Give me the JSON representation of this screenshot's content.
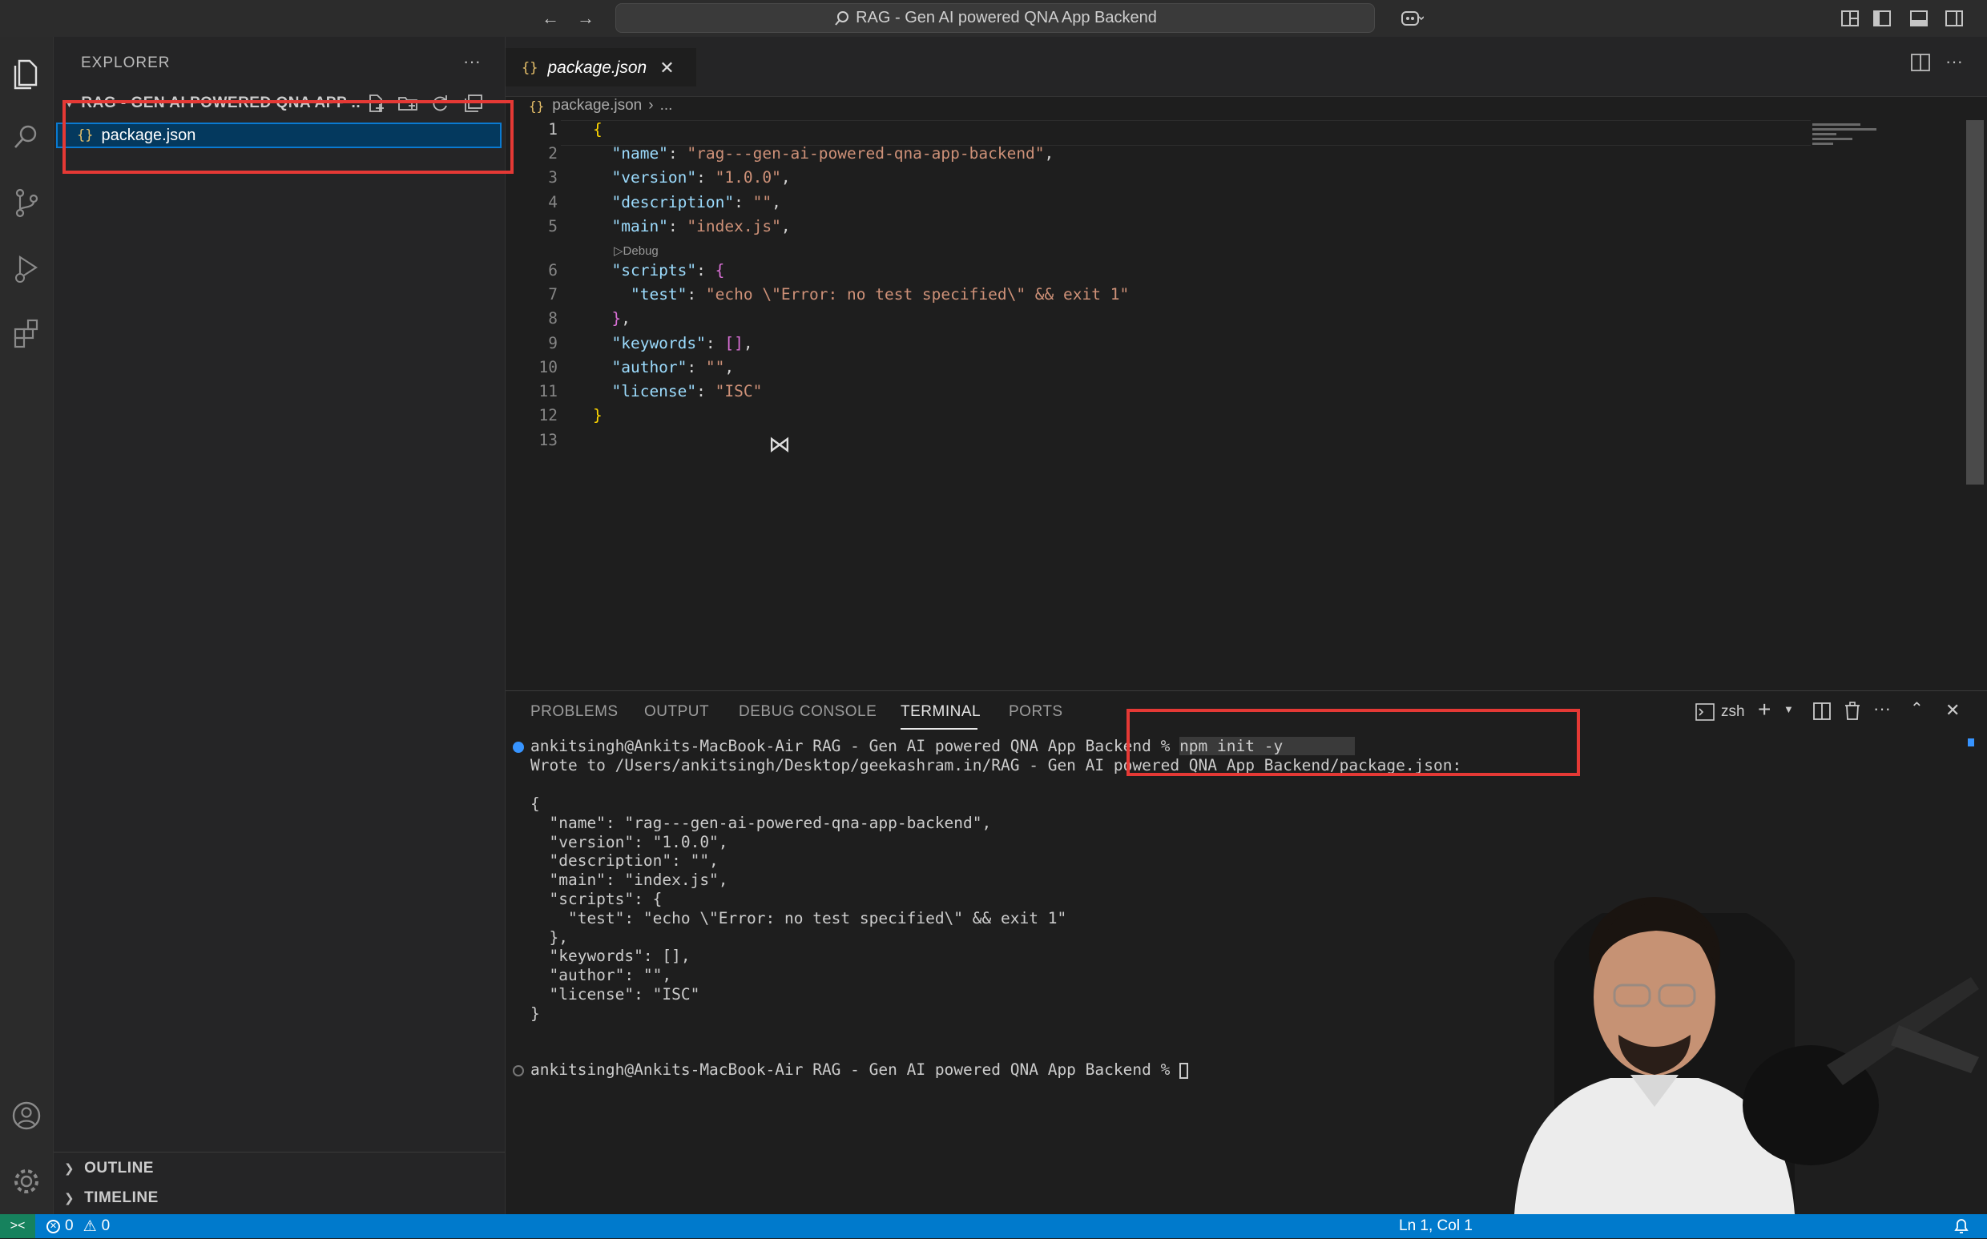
{
  "titlebar": {
    "search_text": "RAG - Gen AI powered QNA App Backend"
  },
  "sidebar": {
    "title": "EXPLORER",
    "more": "···",
    "folder_name": "RAG - GEN AI POWERED QNA APP ...",
    "file_name": "package.json",
    "outline_label": "OUTLINE",
    "timeline_label": "TIMELINE"
  },
  "editor": {
    "tab_label": "package.json",
    "breadcrumb_file": "package.json",
    "breadcrumb_rest": "...",
    "codelens": "Debug",
    "line_numbers": [
      "1",
      "2",
      "3",
      "4",
      "5",
      "6",
      "7",
      "8",
      "9",
      "10",
      "11",
      "12",
      "13"
    ]
  },
  "panel": {
    "tabs": [
      "PROBLEMS",
      "OUTPUT",
      "DEBUG CONSOLE",
      "TERMINAL",
      "PORTS"
    ],
    "active_tab": "TERMINAL",
    "shell_label": "zsh",
    "prompt": "ankitsingh@Ankits-MacBook-Air RAG - Gen AI powered QNA App Backend % ",
    "command": "npm init -y",
    "output_line": "Wrote to /Users/ankitsingh/Desktop/geekashram.in/RAG - Gen AI powered QNA App Backend/package.json:",
    "json_lines": [
      "{",
      "  \"name\": \"rag---gen-ai-powered-qna-app-backend\",",
      "  \"version\": \"1.0.0\",",
      "  \"description\": \"\",",
      "  \"main\": \"index.js\",",
      "  \"scripts\": {",
      "    \"test\": \"echo \\\"Error: no test specified\\\" && exit 1\"",
      "  },",
      "  \"keywords\": [],",
      "  \"author\": \"\",",
      "  \"license\": \"ISC\"",
      "}"
    ],
    "prompt2": "ankitsingh@Ankits-MacBook-Air RAG - Gen AI powered QNA App Backend % "
  },
  "statusbar": {
    "errors": "0",
    "warnings": "0",
    "cursor": "Ln 1, Col 1"
  },
  "colors": {
    "accent": "#007acc",
    "highlight_box": "#e53935",
    "selection": "#04395e"
  }
}
